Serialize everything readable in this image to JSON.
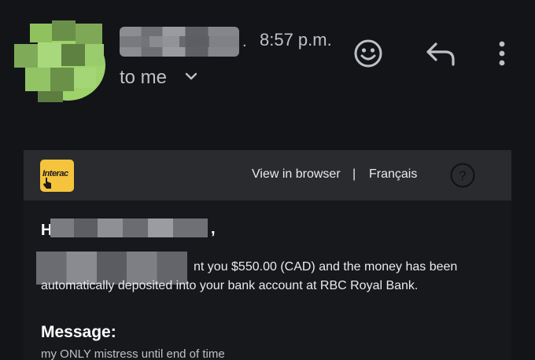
{
  "header": {
    "time": "8:57 p.m.",
    "separator": ".",
    "recipient": "to me"
  },
  "actions": {
    "emoji_icon": "smiley-face-icon",
    "reply_icon": "reply-arrow-icon",
    "more_icon": "more-vertical-icon"
  },
  "banner": {
    "logo_text": "Interac",
    "view_in_browser": "View in browser",
    "separator": "|",
    "language": "Français",
    "help_icon": "question-mark-icon"
  },
  "email_body": {
    "greeting_prefix": "Hi",
    "greeting_suffix": ",",
    "line1": "nt you $550.00 (CAD) and the money has been",
    "line2": "automatically deposited into your bank account at RBC Royal Bank.",
    "message_label": "Message:",
    "message_text": "my ONLY mistress until end of time"
  },
  "colors": {
    "background": "#131418",
    "banner": "#2a2b2f",
    "logo": "#f5c33c",
    "avatar": "#9dd36a"
  }
}
